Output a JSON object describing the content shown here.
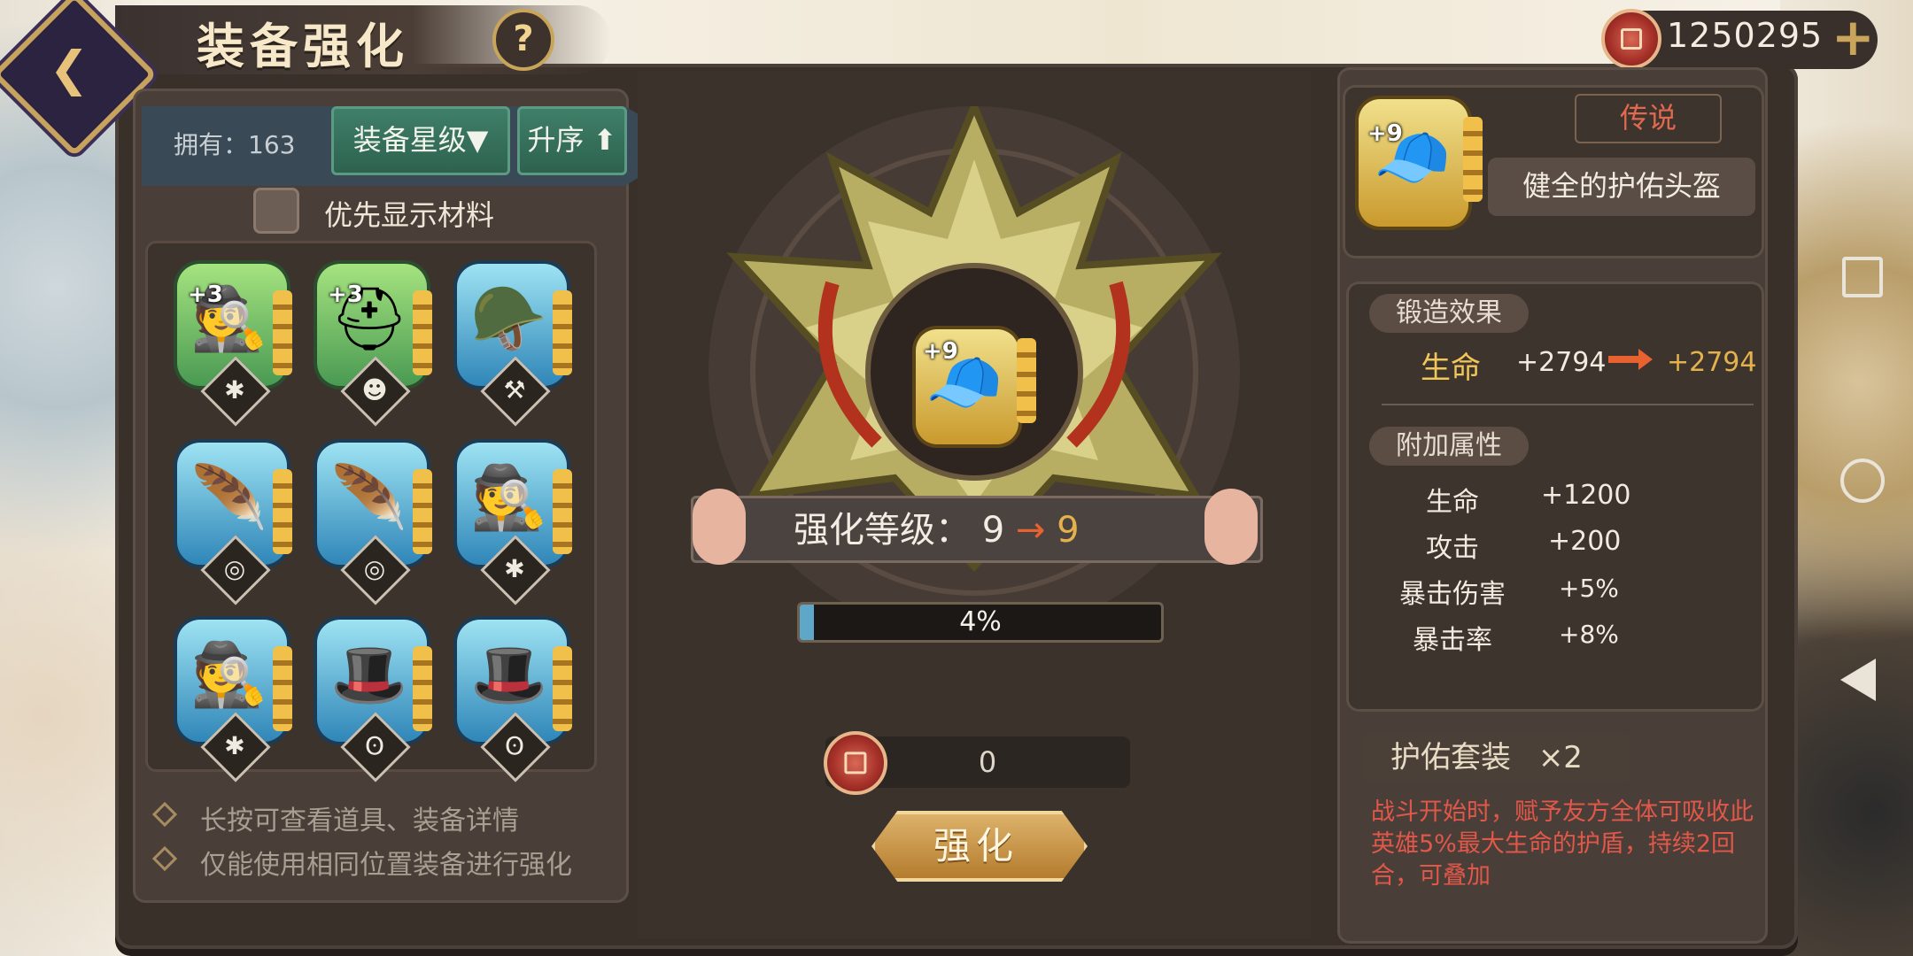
{
  "header": {
    "title": "装备强化",
    "help_label": "?",
    "currency": "1250295",
    "add_label": "+"
  },
  "sort": {
    "owned_text": "拥有：163",
    "star_label": "装备星级▼",
    "order_label": "升序 ⬆"
  },
  "filter": {
    "material_priority_label": "优先显示材料"
  },
  "inventory": [
    {
      "level": "+3",
      "art": "🕵",
      "rarity": "green",
      "slot": "✱"
    },
    {
      "level": "+3",
      "art": "⛑",
      "rarity": "green",
      "slot": "☻"
    },
    {
      "level": "",
      "art": "🪖",
      "rarity": "blue",
      "slot": "⚒"
    },
    {
      "level": "",
      "art": "🪶",
      "rarity": "blue",
      "slot": "◎"
    },
    {
      "level": "",
      "art": "🪶",
      "rarity": "blue",
      "slot": "◎"
    },
    {
      "level": "",
      "art": "🕵",
      "rarity": "blue",
      "slot": "✱"
    },
    {
      "level": "",
      "art": "🕵",
      "rarity": "blue",
      "slot": "✱"
    },
    {
      "level": "",
      "art": "🎩",
      "rarity": "blue",
      "slot": "ʘ"
    },
    {
      "level": "",
      "art": "🎩",
      "rarity": "blue",
      "slot": "ʘ"
    }
  ],
  "tips": [
    "长按可查看道具、装备详情",
    "仅能使用相同位置装备进行强化"
  ],
  "center": {
    "item_level": "+9",
    "enhance_label": "强化等级：",
    "level_from": "9",
    "level_arrow": "→",
    "level_to": "9",
    "progress_text": "4%",
    "progress_value": 0.04,
    "cost": "0",
    "enhance_button": "强化"
  },
  "detail": {
    "item_level": "+9",
    "rarity": "传说",
    "name": "健全的护佑头盔",
    "forge_title": "锻造效果",
    "forge": {
      "label": "生命",
      "from": "+2794",
      "to": "+2794"
    },
    "extra_title": "附加属性",
    "extra": [
      {
        "label": "生命",
        "value": "+1200"
      },
      {
        "label": "攻击",
        "value": "+200"
      },
      {
        "label": "暴击伤害",
        "value": "+5%"
      },
      {
        "label": "暴击率",
        "value": "+8%"
      }
    ],
    "set_name": "护佑套装",
    "set_count": "×2",
    "set_desc": "战斗开始时，赋予友方全体可吸收此英雄5%最大生命的护盾，持续2回合，可叠加"
  },
  "colors": {
    "accent_gold": "#e4b24a",
    "green_btn": "#2d624f",
    "red_text": "#e1574a",
    "orange_arrow": "#e8622f"
  }
}
